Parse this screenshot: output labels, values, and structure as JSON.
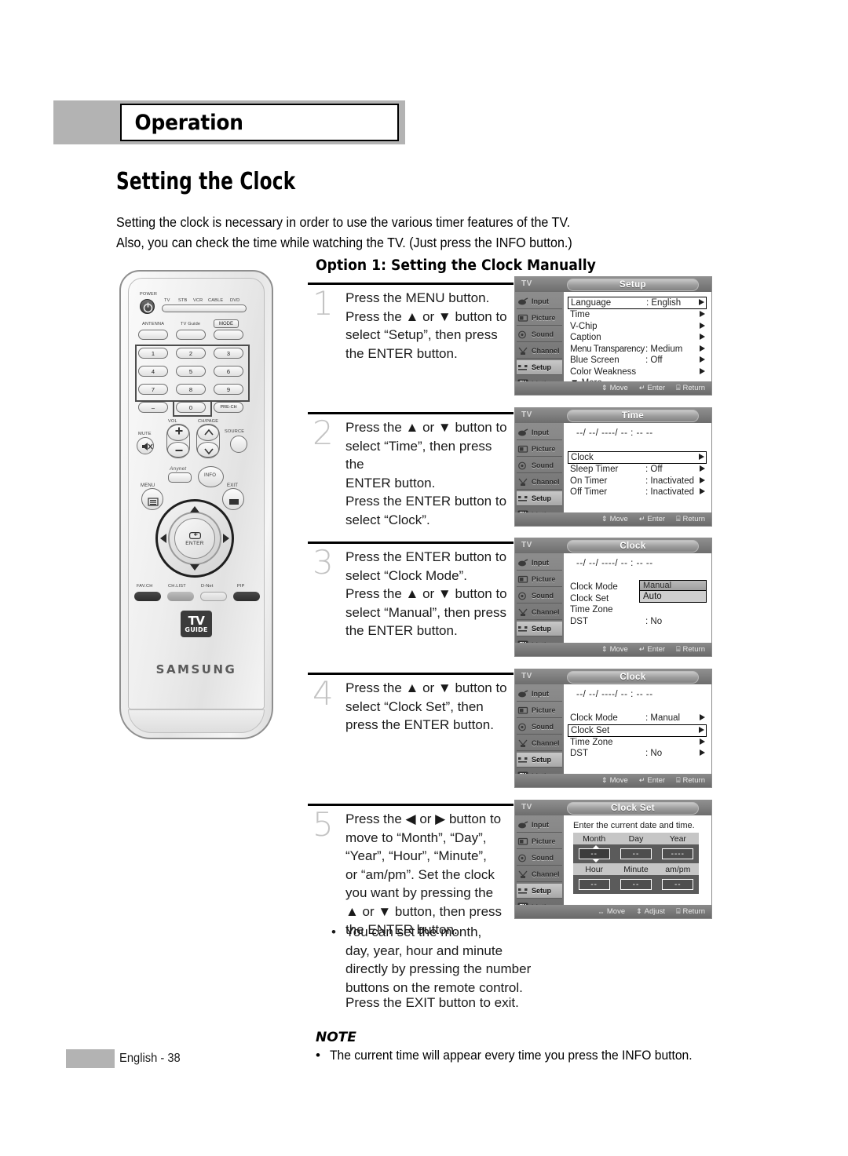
{
  "chapter": {
    "title": "Operation"
  },
  "page_title": "Setting the Clock",
  "intro": {
    "line1": "Setting the clock is necessary in order to use the various timer features of the TV.",
    "line2": "Also, you can check the time while watching the TV. (Just press the INFO button.)"
  },
  "option_heading": "Option 1: Setting the Clock Manually",
  "steps": [
    {
      "number": "1",
      "lines": [
        "Press the MENU button.",
        "Press the ▲ or ▼ button to",
        "select “Setup”, then press",
        "the ENTER button."
      ]
    },
    {
      "number": "2",
      "lines": [
        "Press the ▲ or ▼ button to",
        "select “Time”, then press the",
        "ENTER button.",
        "Press the ENTER button to",
        "select “Clock”."
      ]
    },
    {
      "number": "3",
      "lines": [
        "Press the ENTER button to",
        "select “Clock Mode”.",
        "Press the ▲ or ▼ button to",
        "select “Manual”, then press",
        "the ENTER button."
      ]
    },
    {
      "number": "4",
      "lines": [
        "Press the ▲ or ▼ button to",
        "select “Clock Set”, then",
        "press the ENTER button."
      ]
    },
    {
      "number": "5",
      "lines": [
        "Press the ◀ or ▶ button to",
        "move to “Month”, “Day”,",
        "“Year”, “Hour”, “Minute”,",
        "or “am/pm”. Set the clock",
        "you want by pressing the",
        "▲ or ▼ button, then press",
        "the ENTER button."
      ]
    }
  ],
  "sub_bullet": {
    "marker": "•",
    "lines": [
      "You can set the month,",
      "day, year, hour and minute",
      "directly by pressing the number",
      "buttons on the remote control."
    ]
  },
  "exit_line": "Press the EXIT button to exit.",
  "note": {
    "title": "NOTE",
    "marker": "•",
    "text": "The current time will appear every time you press the INFO button."
  },
  "footer": {
    "page_label": "English - 38"
  },
  "osd_common": {
    "tv_label": "TV",
    "side_items": [
      {
        "label": "Input",
        "icon": "input-icon"
      },
      {
        "label": "Picture",
        "icon": "picture-icon"
      },
      {
        "label": "Sound",
        "icon": "sound-icon"
      },
      {
        "label": "Channel",
        "icon": "channel-icon"
      },
      {
        "label": "Setup",
        "icon": "setup-icon"
      },
      {
        "label": "Listings",
        "icon": "tvguide-icon"
      }
    ],
    "active_side_item": "Setup",
    "hints_move_enter_return": [
      {
        "glyph": "⇕",
        "label": "Move"
      },
      {
        "glyph": "↵",
        "label": "Enter"
      },
      {
        "glyph": "⌸",
        "label": "Return"
      }
    ],
    "hints_move_adjust_return": [
      {
        "glyph": "⇔",
        "label": "Move"
      },
      {
        "glyph": "⇕",
        "label": "Adjust"
      },
      {
        "glyph": "⌸",
        "label": "Return"
      }
    ],
    "time_placeholder": "--/ --/ ----/ -- : -- --"
  },
  "osd_panels": [
    {
      "id": "setup",
      "title": "Setup",
      "rows": [
        {
          "label": "Language",
          "value": ": English",
          "arrow": true,
          "selected": true
        },
        {
          "label": "Time",
          "value": "",
          "arrow": true,
          "selected": false
        },
        {
          "label": "V-Chip",
          "value": "",
          "arrow": true,
          "selected": false
        },
        {
          "label": "Caption",
          "value": "",
          "arrow": true,
          "selected": false
        },
        {
          "label": "Menu Transparency",
          "value": ": Medium",
          "arrow": true,
          "selected": false
        },
        {
          "label": "Blue Screen",
          "value": ": Off",
          "arrow": true,
          "selected": false
        },
        {
          "label": "Color Weakness",
          "value": "",
          "arrow": true,
          "selected": false
        },
        {
          "label": "▼ More",
          "value": "",
          "arrow": false,
          "selected": false
        }
      ]
    },
    {
      "id": "time",
      "title": "Time",
      "rows": [
        {
          "label": "Clock",
          "value": "",
          "arrow": true,
          "selected": true
        },
        {
          "label": "Sleep Timer",
          "value": ": Off",
          "arrow": true,
          "selected": false
        },
        {
          "label": "On Timer",
          "value": ": Inactivated",
          "arrow": true,
          "selected": false
        },
        {
          "label": "Off Timer",
          "value": ": Inactivated",
          "arrow": true,
          "selected": false
        }
      ]
    },
    {
      "id": "clock-mode",
      "title": "Clock",
      "rows": [
        {
          "label": "Clock Mode",
          "value": "",
          "arrow": false,
          "selected": false
        },
        {
          "label": "Clock Set",
          "value": "",
          "arrow": false,
          "selected": false
        },
        {
          "label": "Time Zone",
          "value": "",
          "arrow": false,
          "selected": false
        },
        {
          "label": "DST",
          "value": ": No",
          "arrow": false,
          "selected": false
        }
      ],
      "dropdown": {
        "selected": "Manual",
        "option": "Auto"
      }
    },
    {
      "id": "clock-set-sel",
      "title": "Clock",
      "rows": [
        {
          "label": "Clock Mode",
          "value": ": Manual",
          "arrow": true,
          "selected": false
        },
        {
          "label": "Clock Set",
          "value": "",
          "arrow": true,
          "selected": true
        },
        {
          "label": "Time Zone",
          "value": "",
          "arrow": true,
          "selected": false
        },
        {
          "label": "DST",
          "value": ": No",
          "arrow": true,
          "selected": false
        }
      ]
    },
    {
      "id": "clock-set",
      "title": "Clock Set",
      "prompt": "Enter the current date and time.",
      "date_headers": [
        "Month",
        "Day",
        "Year"
      ],
      "date_values": [
        "--",
        "--",
        "----"
      ],
      "time_headers": [
        "Hour",
        "Minute",
        "am/pm"
      ],
      "time_values": [
        "--",
        "--",
        "--"
      ],
      "selected_field": "Month"
    }
  ],
  "remote": {
    "brand": "SAMSUNG",
    "tvguide_line1": "TV",
    "tvguide_line2": "GUIDE",
    "power_label": "POWER",
    "device_labels": [
      "TV",
      "STB",
      "VCR",
      "CABLE",
      "DVD"
    ],
    "row_labels": [
      "ANTENNA",
      "TV Guide",
      "MODE"
    ],
    "number_keys": [
      "1",
      "2",
      "3",
      "4",
      "5",
      "6",
      "7",
      "8",
      "9",
      "–",
      "0",
      "PRE-CH"
    ],
    "vol_label": "VOL",
    "chpage_label": "CH/PAGE",
    "mute_label": "MUTE",
    "source_label": "SOURCE",
    "info_label": "INFO",
    "menu_label": "MENU",
    "exit_label": "EXIT",
    "anynet_label": "Anynet",
    "enter_label": "ENTER",
    "bottom_keys": [
      "FAV.CH",
      "CH.LIST",
      "D-Net",
      "PIP"
    ]
  },
  "colors": {
    "banner_gray": "#b3b3b3",
    "step_number_gray": "#c3c3c3",
    "osd_bar": "#7a7a7a",
    "text": "#1a1a1a"
  }
}
